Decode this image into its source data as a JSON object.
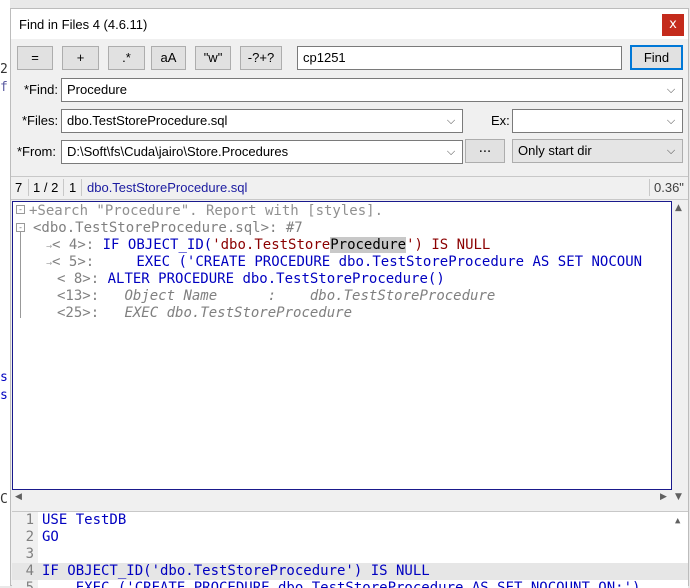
{
  "window": {
    "title": "Find in Files 4 (4.6.11)",
    "close_label": "x"
  },
  "toolbar": {
    "buttons": [
      "=",
      "+",
      ".*",
      "aA",
      "\"w\"",
      "-?+?"
    ],
    "encoding": "cp1251",
    "find_label": "Find"
  },
  "form": {
    "find_label": "*Find:",
    "find_value": "Procedure",
    "files_label": "*Files:",
    "files_value": "dbo.TestStoreProcedure.sql",
    "ex_label": "Ex:",
    "ex_value": "",
    "from_label": "*From:",
    "from_value": "D:\\Soft\\fs\\Cuda\\jairo\\Store.Procedures",
    "browse_label": "...",
    "dir_option": "Only start dir"
  },
  "status": {
    "count": "7",
    "index": "1 / 2",
    "files": "1",
    "filename": "dbo.TestStoreProcedure.sql",
    "time": "0.36\""
  },
  "results": {
    "header": "+Search \"Procedure\". Report with [styles].",
    "file_line": "<dbo.TestStoreProcedure.sql>: #7",
    "lines": [
      {
        "num": "< 4>:",
        "text_a": "IF OBJECT_ID(",
        "text_str": "'dbo.TestStore",
        "text_match": "Procedure",
        "text_end": "') IS NULL"
      },
      {
        "num": "< 5>:",
        "text": "    EXEC ('CREATE PROCEDURE dbo.TestStoreProcedure AS SET NOCOUN"
      },
      {
        "num": "< 8>:",
        "text": "ALTER PROCEDURE dbo.TestStoreProcedure()"
      },
      {
        "num": "<13>:",
        "text": "  Object Name      :    dbo.TestStoreProcedure"
      },
      {
        "num": "<25>:",
        "text": "  EXEC dbo.TestStoreProcedure"
      }
    ]
  },
  "preview": {
    "lines": [
      {
        "num": "1",
        "text": "USE TestDB"
      },
      {
        "num": "2",
        "text": "GO"
      },
      {
        "num": "3",
        "text": ""
      },
      {
        "num": "4",
        "text": "IF OBJECT_ID('dbo.TestStoreProcedure') IS NULL"
      },
      {
        "num": "5",
        "text": "    EXEC ('CREATE PROCEDURE dbo.TestStoreProcedure AS SET NOCOUNT ON;')"
      }
    ]
  }
}
